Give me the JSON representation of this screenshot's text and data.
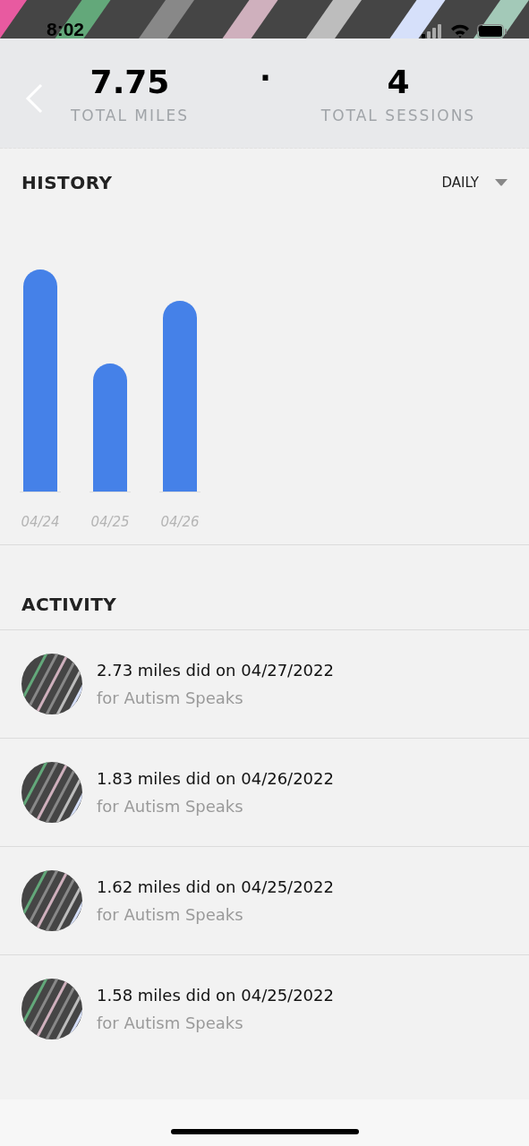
{
  "status_bar": {
    "time": "8:02"
  },
  "summary": {
    "miles": "7.75",
    "miles_label": "TOTAL MILES",
    "separator": "·",
    "sessions": "4",
    "sessions_label": "TOTAL SESSIONS"
  },
  "history": {
    "title": "HISTORY",
    "period": "DAILY",
    "date_labels": [
      "04/24",
      "04/25",
      "04/26"
    ]
  },
  "activity": {
    "title": "ACTIVITY",
    "items": [
      {
        "title": "2.73 miles did on 04/27/2022",
        "subtitle": "for Autism Speaks"
      },
      {
        "title": "1.83 miles did on 04/26/2022",
        "subtitle": "for Autism Speaks"
      },
      {
        "title": "1.62 miles did on 04/25/2022",
        "subtitle": "for Autism Speaks"
      },
      {
        "title": "1.58 miles did on 04/25/2022",
        "subtitle": "for Autism Speaks"
      }
    ]
  }
}
